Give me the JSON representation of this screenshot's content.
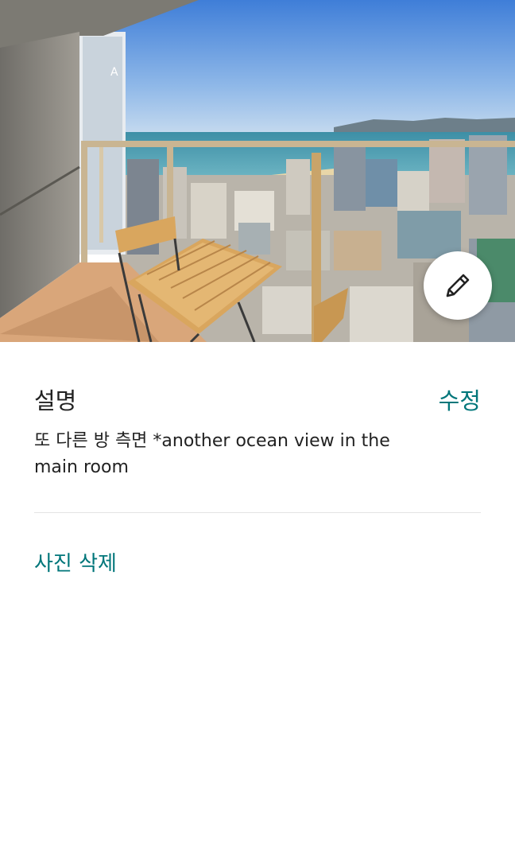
{
  "photo": {
    "alt": "balcony ocean view photo",
    "edit_icon": "pencil-icon"
  },
  "description_section": {
    "title": "설명",
    "edit_label": "수정",
    "text": "또 다른 방 측면 *another ocean view in the main room"
  },
  "actions": {
    "delete_photo_label": "사진 삭제"
  },
  "colors": {
    "accent": "#00767a",
    "text": "#222222",
    "divider": "#e4e4e4"
  }
}
